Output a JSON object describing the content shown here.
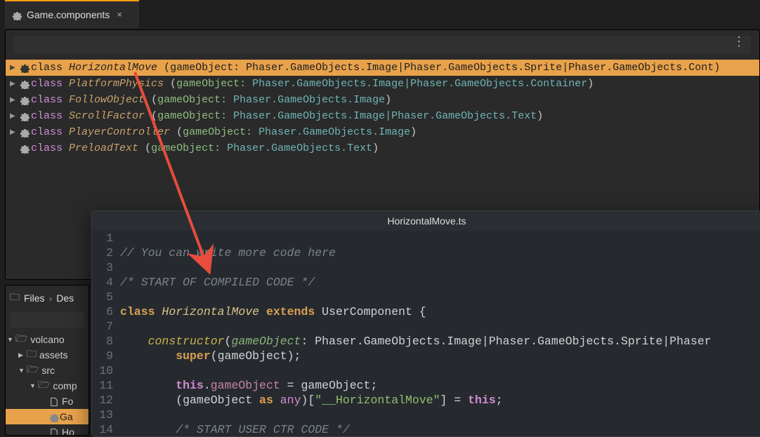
{
  "tab": {
    "label": "Game.components"
  },
  "components": [
    {
      "expandable": true,
      "selected": true,
      "name": "HorizontalMove",
      "params": "gameObject: Phaser.GameObjects.Image|Phaser.GameObjects.Sprite|Phaser.GameObjects.Cont"
    },
    {
      "expandable": true,
      "selected": false,
      "name": "PlatformPhysics",
      "params": "gameObject: Phaser.GameObjects.Image|Phaser.GameObjects.Container"
    },
    {
      "expandable": true,
      "selected": false,
      "name": "FollowObject",
      "params": "gameObject: Phaser.GameObjects.Image"
    },
    {
      "expandable": true,
      "selected": false,
      "name": "ScrollFactor",
      "params": "gameObject: Phaser.GameObjects.Image|Phaser.GameObjects.Text"
    },
    {
      "expandable": true,
      "selected": false,
      "name": "PlayerController",
      "params": "gameObject: Phaser.GameObjects.Image"
    },
    {
      "expandable": false,
      "selected": false,
      "name": "PreloadText",
      "params": "gameObject: Phaser.GameObjects.Text"
    }
  ],
  "files": {
    "crumb1": "Files",
    "crumb2": "Des",
    "tree": [
      {
        "depth": 0,
        "kind": "folder-open",
        "label": "volcano",
        "selected": false
      },
      {
        "depth": 1,
        "kind": "folder",
        "label": "assets",
        "selected": false
      },
      {
        "depth": 1,
        "kind": "folder-open",
        "label": "src",
        "selected": false
      },
      {
        "depth": 2,
        "kind": "folder-open",
        "label": "comp",
        "selected": false
      },
      {
        "depth": 3,
        "kind": "page",
        "label": "Fo",
        "selected": false
      },
      {
        "depth": 3,
        "kind": "gear",
        "label": "Ga",
        "selected": true
      },
      {
        "depth": 3,
        "kind": "page",
        "label": "Ho",
        "selected": false
      }
    ]
  },
  "editor": {
    "title": "HorizontalMove.ts",
    "lines": {
      "l1": "",
      "l2": "// You can write more code here",
      "l3": "",
      "l4": "/* START OF COMPILED CODE */",
      "l5": "",
      "l6_kw_class": "class",
      "l6_cls": "HorizontalMove",
      "l6_kw_ext": "extends",
      "l6_sup": "UserComponent",
      "l7": "",
      "l8_fn": "constructor",
      "l8_param": "gameObject",
      "l8_types": "Phaser.GameObjects.Image|Phaser.GameObjects.Sprite|Phaser",
      "l9_super": "super",
      "l9_arg": "gameObject",
      "l10": "",
      "l11_this": "this",
      "l11_prop": "gameObject",
      "l11_rhs": "gameObject",
      "l12_lhs": "gameObject",
      "l12_as": "as",
      "l12_any": "any",
      "l12_str": "\"__HorizontalMove\"",
      "l12_this": "this",
      "l13": "",
      "l14": "/* START USER CTR CODE */"
    }
  }
}
